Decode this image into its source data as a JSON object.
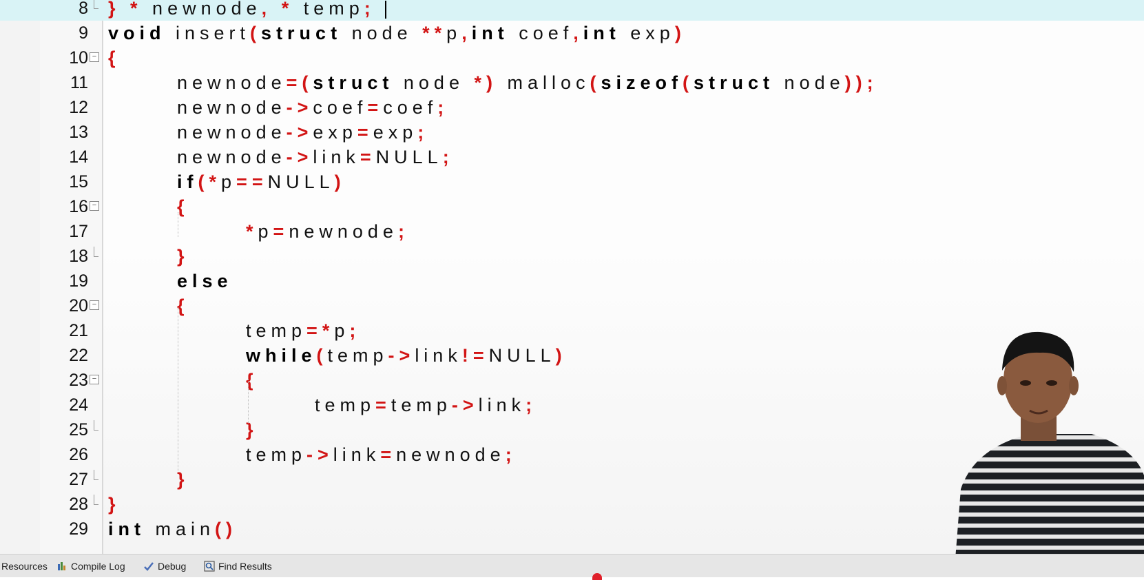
{
  "editor": {
    "lines": [
      {
        "num": "8",
        "indent": 0,
        "tokens": [
          [
            "p",
            "}"
          ],
          [
            "t",
            " "
          ],
          [
            "p",
            "*"
          ],
          [
            "t",
            " newnode"
          ],
          [
            "p",
            ","
          ],
          [
            "t",
            " "
          ],
          [
            "p",
            "*"
          ],
          [
            "t",
            " temp"
          ],
          [
            "p",
            ";"
          ]
        ],
        "current": true,
        "fold": "end"
      },
      {
        "num": "9",
        "indent": 0,
        "tokens": [
          [
            "k",
            "void"
          ],
          [
            "t",
            " insert"
          ],
          [
            "p",
            "("
          ],
          [
            "k",
            "struct"
          ],
          [
            "t",
            " node "
          ],
          [
            "p",
            "**"
          ],
          [
            "t",
            "p"
          ],
          [
            "p",
            ","
          ],
          [
            "k",
            "int"
          ],
          [
            "t",
            " coef"
          ],
          [
            "p",
            ","
          ],
          [
            "k",
            "int"
          ],
          [
            "t",
            " exp"
          ],
          [
            "p",
            ")"
          ]
        ]
      },
      {
        "num": "10",
        "indent": 0,
        "tokens": [
          [
            "p",
            "{"
          ]
        ],
        "fold": "open"
      },
      {
        "num": "11",
        "indent": 1,
        "tokens": [
          [
            "t",
            "newnode"
          ],
          [
            "p",
            "=("
          ],
          [
            "k",
            "struct"
          ],
          [
            "t",
            " node "
          ],
          [
            "p",
            "*)"
          ],
          [
            "t",
            " malloc"
          ],
          [
            "p",
            "("
          ],
          [
            "k",
            "sizeof"
          ],
          [
            "p",
            "("
          ],
          [
            "k",
            "struct"
          ],
          [
            "t",
            " node"
          ],
          [
            "p",
            "));"
          ]
        ]
      },
      {
        "num": "12",
        "indent": 1,
        "tokens": [
          [
            "t",
            "newnode"
          ],
          [
            "p",
            "->"
          ],
          [
            "t",
            "coef"
          ],
          [
            "p",
            "="
          ],
          [
            "t",
            "coef"
          ],
          [
            "p",
            ";"
          ]
        ]
      },
      {
        "num": "13",
        "indent": 1,
        "tokens": [
          [
            "t",
            "newnode"
          ],
          [
            "p",
            "->"
          ],
          [
            "t",
            "exp"
          ],
          [
            "p",
            "="
          ],
          [
            "t",
            "exp"
          ],
          [
            "p",
            ";"
          ]
        ]
      },
      {
        "num": "14",
        "indent": 1,
        "tokens": [
          [
            "t",
            "newnode"
          ],
          [
            "p",
            "->"
          ],
          [
            "t",
            "link"
          ],
          [
            "p",
            "="
          ],
          [
            "t",
            "NULL"
          ],
          [
            "p",
            ";"
          ]
        ]
      },
      {
        "num": "15",
        "indent": 1,
        "tokens": [
          [
            "k",
            "if"
          ],
          [
            "p",
            "("
          ],
          [
            "p",
            "*"
          ],
          [
            "t",
            "p"
          ],
          [
            "p",
            "=="
          ],
          [
            "t",
            "NULL"
          ],
          [
            "p",
            ")"
          ]
        ]
      },
      {
        "num": "16",
        "indent": 1,
        "tokens": [
          [
            "p",
            "{"
          ]
        ],
        "fold": "open"
      },
      {
        "num": "17",
        "indent": 2,
        "tokens": [
          [
            "p",
            "*"
          ],
          [
            "t",
            "p"
          ],
          [
            "p",
            "="
          ],
          [
            "t",
            "newnode"
          ],
          [
            "p",
            ";"
          ]
        ]
      },
      {
        "num": "18",
        "indent": 1,
        "tokens": [
          [
            "p",
            "}"
          ]
        ],
        "fold": "end"
      },
      {
        "num": "19",
        "indent": 1,
        "tokens": [
          [
            "k",
            "else"
          ]
        ]
      },
      {
        "num": "20",
        "indent": 1,
        "tokens": [
          [
            "p",
            "{"
          ]
        ],
        "fold": "open"
      },
      {
        "num": "21",
        "indent": 2,
        "tokens": [
          [
            "t",
            "temp"
          ],
          [
            "p",
            "="
          ],
          [
            "p",
            "*"
          ],
          [
            "t",
            "p"
          ],
          [
            "p",
            ";"
          ]
        ]
      },
      {
        "num": "22",
        "indent": 2,
        "tokens": [
          [
            "k",
            "while"
          ],
          [
            "p",
            "("
          ],
          [
            "t",
            "temp"
          ],
          [
            "p",
            "->"
          ],
          [
            "t",
            "link"
          ],
          [
            "p",
            "!="
          ],
          [
            "t",
            "NULL"
          ],
          [
            "p",
            ")"
          ]
        ]
      },
      {
        "num": "23",
        "indent": 2,
        "tokens": [
          [
            "p",
            "{"
          ]
        ],
        "fold": "open"
      },
      {
        "num": "24",
        "indent": 3,
        "tokens": [
          [
            "t",
            "temp"
          ],
          [
            "p",
            "="
          ],
          [
            "t",
            "temp"
          ],
          [
            "p",
            "->"
          ],
          [
            "t",
            "link"
          ],
          [
            "p",
            ";"
          ]
        ]
      },
      {
        "num": "25",
        "indent": 2,
        "tokens": [
          [
            "p",
            "}"
          ]
        ],
        "fold": "end"
      },
      {
        "num": "26",
        "indent": 2,
        "tokens": [
          [
            "t",
            "temp"
          ],
          [
            "p",
            "->"
          ],
          [
            "t",
            "link"
          ],
          [
            "p",
            "="
          ],
          [
            "t",
            "newnode"
          ],
          [
            "p",
            ";"
          ]
        ]
      },
      {
        "num": "27",
        "indent": 1,
        "tokens": [
          [
            "p",
            "}"
          ]
        ],
        "fold": "end"
      },
      {
        "num": "28",
        "indent": 0,
        "tokens": [
          [
            "p",
            "}"
          ]
        ],
        "fold": "end"
      },
      {
        "num": "29",
        "indent": 0,
        "tokens": [
          [
            "k",
            "int"
          ],
          [
            "t",
            " main"
          ],
          [
            "p",
            "()"
          ]
        ]
      }
    ]
  },
  "bottom_tabs": [
    {
      "label": "Resources",
      "icon": "resources-icon"
    },
    {
      "label": "Compile Log",
      "icon": "compile-log-icon"
    },
    {
      "label": "Debug",
      "icon": "debug-check-icon"
    },
    {
      "label": "Find Results",
      "icon": "find-results-icon"
    }
  ],
  "colors": {
    "punct": "#d21414",
    "current_line": "#d9f3f6"
  }
}
